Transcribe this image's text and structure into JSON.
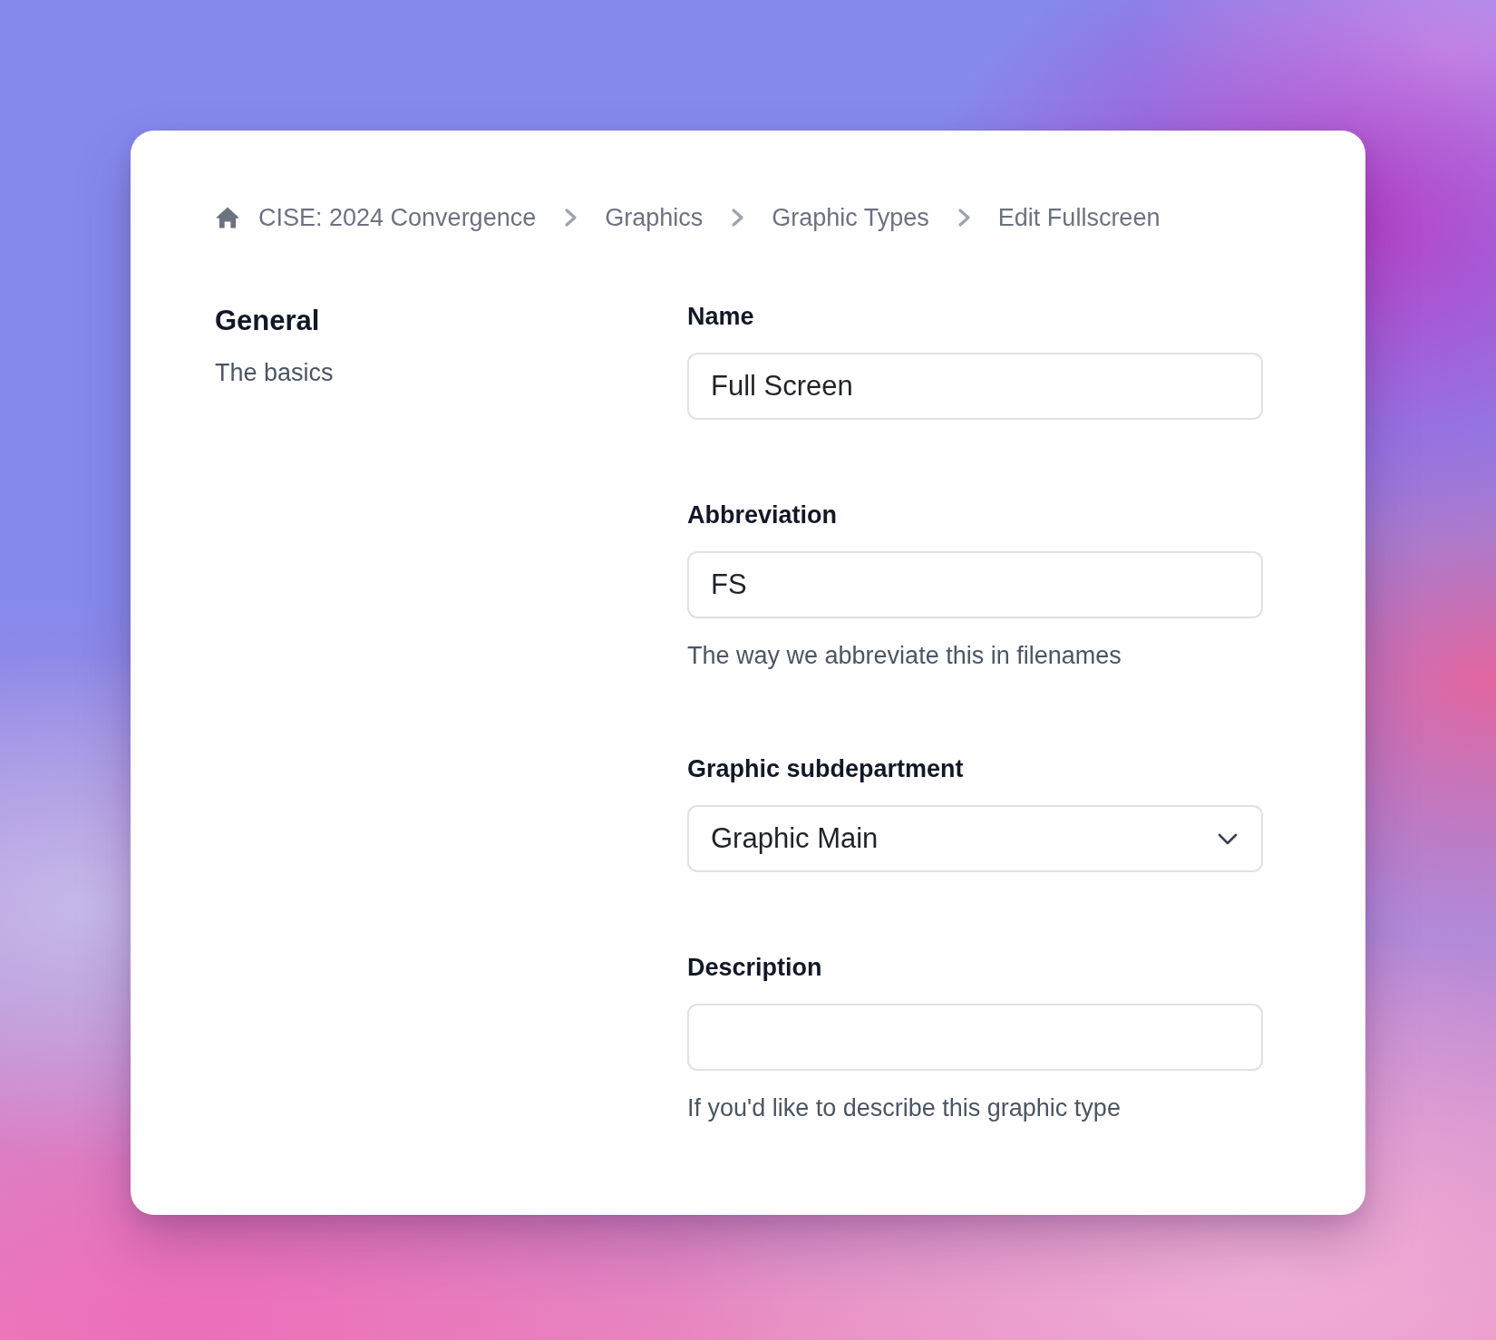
{
  "breadcrumb": [
    {
      "label": "CISE: 2024 Convergence"
    },
    {
      "label": "Graphics"
    },
    {
      "label": "Graphic Types"
    },
    {
      "label": "Edit Fullscreen"
    }
  ],
  "section": {
    "title": "General",
    "subtitle": "The basics"
  },
  "fields": [
    {
      "kind": "text",
      "label": "Name",
      "value": "Full Screen"
    },
    {
      "kind": "text",
      "label": "Abbreviation",
      "value": "FS",
      "help": "The way we abbreviate this in filenames"
    },
    {
      "kind": "select",
      "label": "Graphic subdepartment",
      "value": "Graphic Main"
    },
    {
      "kind": "text",
      "label": "Description",
      "help": "If you'd like to describe this graphic type"
    }
  ]
}
